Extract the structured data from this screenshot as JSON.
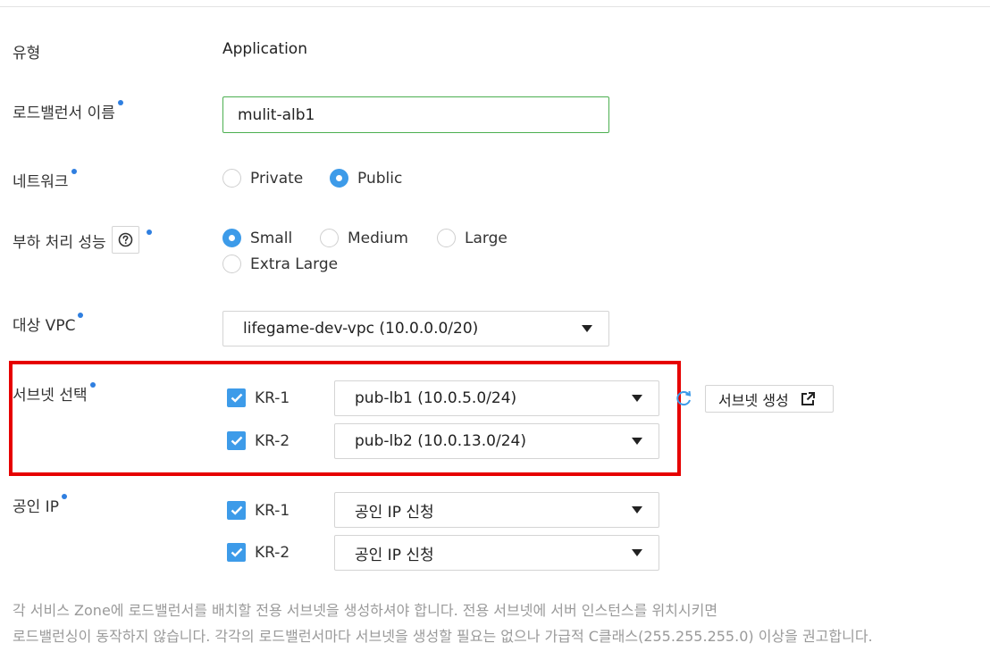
{
  "type_row": {
    "label": "유형",
    "value": "Application"
  },
  "lb_name": {
    "label": "로드밸런서 이름",
    "value": "mulit-alb1"
  },
  "network": {
    "label": "네트워크",
    "options": [
      {
        "label": "Private",
        "checked": false
      },
      {
        "label": "Public",
        "checked": true
      }
    ]
  },
  "performance": {
    "label": "부하 처리 성능",
    "help_icon": "question-circle-icon",
    "options": [
      {
        "label": "Small",
        "checked": true
      },
      {
        "label": "Medium",
        "checked": false
      },
      {
        "label": "Large",
        "checked": false
      },
      {
        "label": "Extra Large",
        "checked": false
      }
    ]
  },
  "vpc": {
    "label": "대상 VPC",
    "selected": "lifegame-dev-vpc (10.0.0.0/20)"
  },
  "subnet": {
    "label": "서브넷 선택",
    "rows": [
      {
        "zone": "KR-1",
        "checked": true,
        "selected": "pub-lb1 (10.0.5.0/24)"
      },
      {
        "zone": "KR-2",
        "checked": true,
        "selected": "pub-lb2 (10.0.13.0/24)"
      }
    ],
    "refresh_icon": "refresh-icon",
    "create_label": "서브넷 생성",
    "create_icon": "external-link-icon"
  },
  "public_ip": {
    "label": "공인 IP",
    "rows": [
      {
        "zone": "KR-1",
        "checked": true,
        "selected": "공인 IP 신청"
      },
      {
        "zone": "KR-2",
        "checked": true,
        "selected": "공인 IP 신청"
      }
    ]
  },
  "notes": [
    "각 서비스 Zone에 로드밸런서를 배치할 전용 서브넷을 생성하셔야 합니다. 전용 서브넷에 서버 인스턴스를 위치시키면",
    "로드밸런싱이 동작하지 않습니다. 각각의 로드밸런서마다 서브넷을 생성할 필요는 없으나 가급적 C클래스(255.255.255.0) 이상을 권고합니다."
  ],
  "colors": {
    "accent": "#3d9be9",
    "required_dot": "#2f7fe0",
    "input_focus_border": "#4caf50",
    "highlight_border": "#e60000"
  }
}
